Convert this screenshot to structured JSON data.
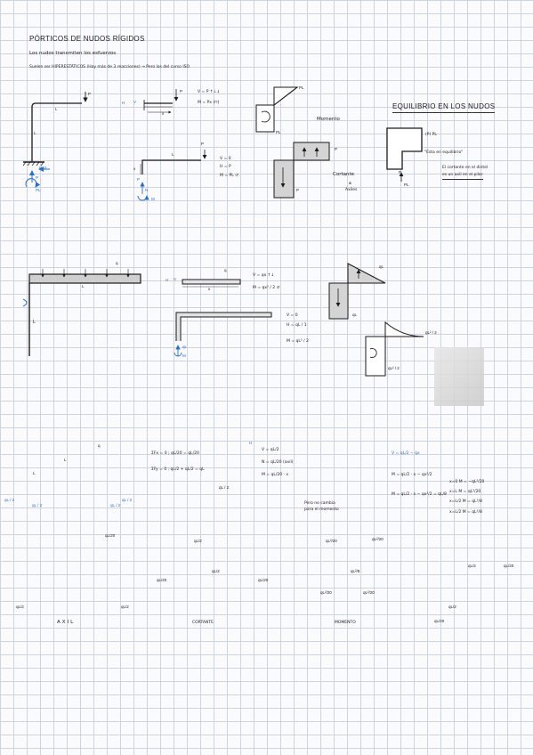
{
  "header": {
    "title": "PÓRTICOS DE NUDOS RÍGIDOS",
    "line1": "Los nudos transmiten los esfuerzos",
    "line2": "Suelen ser HIPERESTÁTICOS (Hay más de 3 reacciones) → Pero los del curso ISO"
  },
  "sec1": {
    "lbl_P": "P",
    "lbl_L_top": "L",
    "lbl_L_col": "L",
    "react_H": "H=0",
    "react_V": "P",
    "react_M": "PL",
    "fb_H": "H",
    "fb_V": "V",
    "fb_x": "x",
    "fb_P": "P",
    "eq_V": "V = P ↑⊥↓",
    "eq_M": "M = Px (⊓)",
    "fb2_L": "L",
    "fb2_P": "P",
    "fb2_x": "x",
    "eq2_V": "V = 0",
    "eq2_H": "H = P",
    "eq2_M": "M = PL ↺",
    "fb2_react_P": "P",
    "fb2_react_N": "N",
    "fb2_react_M": "M",
    "mom_PL_top": "PL",
    "mom_PL_bottom": "PL",
    "mom_label": "Momento",
    "shear_P_top": "P",
    "shear_P_bottom": "P",
    "shear_label": "Cortante",
    "shear_and": "&",
    "axial_label": "Axiles"
  },
  "equilibrium": {
    "title": "EQUILIBRIO EN LOS NUDOS",
    "P_PL": "(P) PL",
    "note": "\"Esta en equilibrio\"",
    "P": "P",
    "PL": "PL",
    "box_line1": "El cortante en el dintel",
    "box_line2": "es un axil en el pilar"
  },
  "sec2": {
    "q": "q",
    "L_top": "L",
    "L_col": "L",
    "fb_H": "H",
    "fb_V": "V",
    "fb_q": "q",
    "fb_x": "x",
    "eq_V": "V = qx ↑↓",
    "eq_M": "M = qx² / 2 ↺",
    "eq2_V": "V = 0",
    "eq2_H": "H = qL / 1",
    "eq2_M": "M = qL² / 2",
    "react_q": "qL",
    "react_M": "M",
    "diag_ql": "qL",
    "diag_ql_b": "qL",
    "mom_ql2": "qL² / 2",
    "mom_ql2_b": "qL² / 2"
  },
  "sec3": {
    "q": "q",
    "L_left": "L",
    "L_right": "L",
    "react_left": "qL / 2",
    "react_right": "qL / 2",
    "h_left": "qL / 2",
    "h_right": "qL / 2",
    "eq_Fx": "ΣFx = 0 ; qL/20 = qL/20",
    "eq_Fy": "ΣFy = 0 ; qL/2 + qL/2 = qL",
    "fb_H": "H",
    "fb_V": "V = qL/2",
    "fb_N": "N = qL/20 (axil)",
    "fb_M": "M = qL/20 · x",
    "fb_react": "qL / 2",
    "note_line1": "Pero no cambia",
    "note_line2": "para el momento",
    "beam_eq1": "V = qL/2 − qx",
    "beam_eq2": "M = qL/2 · x − qx²/2",
    "beam_eq3": "M = qL/2 · x − qx²/2 = qL/8",
    "r1": "x=0  M = −qL²/20",
    "r2": "x=L  M = qL²/20",
    "r3": "x=L/2  M = qL²/8",
    "r4": "x=L/2  M = qL²/8"
  },
  "sec4": {
    "axil_label": "AXIL",
    "cort_label": "CORTANTE",
    "mom_label": "MOMENTO",
    "axil_ql20": "qL/20",
    "axil_ql2_l": "qL/2",
    "axil_ql2_r": "qL/2",
    "cort_ql2": "qL/2",
    "cort_ql2_b": "qL/2",
    "cort_ql20_l": "qL/20",
    "cort_ql20_r": "qL/20",
    "mom_top_l": "qL²/20",
    "mom_top_r": "qL²/20",
    "mom_mid": "qL²/8",
    "mom_bot_l": "qL²/20",
    "mom_bot_r": "qL²/20",
    "eq_ql2": "qL/2",
    "eq_ql20": "qL/20",
    "eq_ql2_b": "qL/2",
    "eq_ql20_b": "qL/20"
  }
}
